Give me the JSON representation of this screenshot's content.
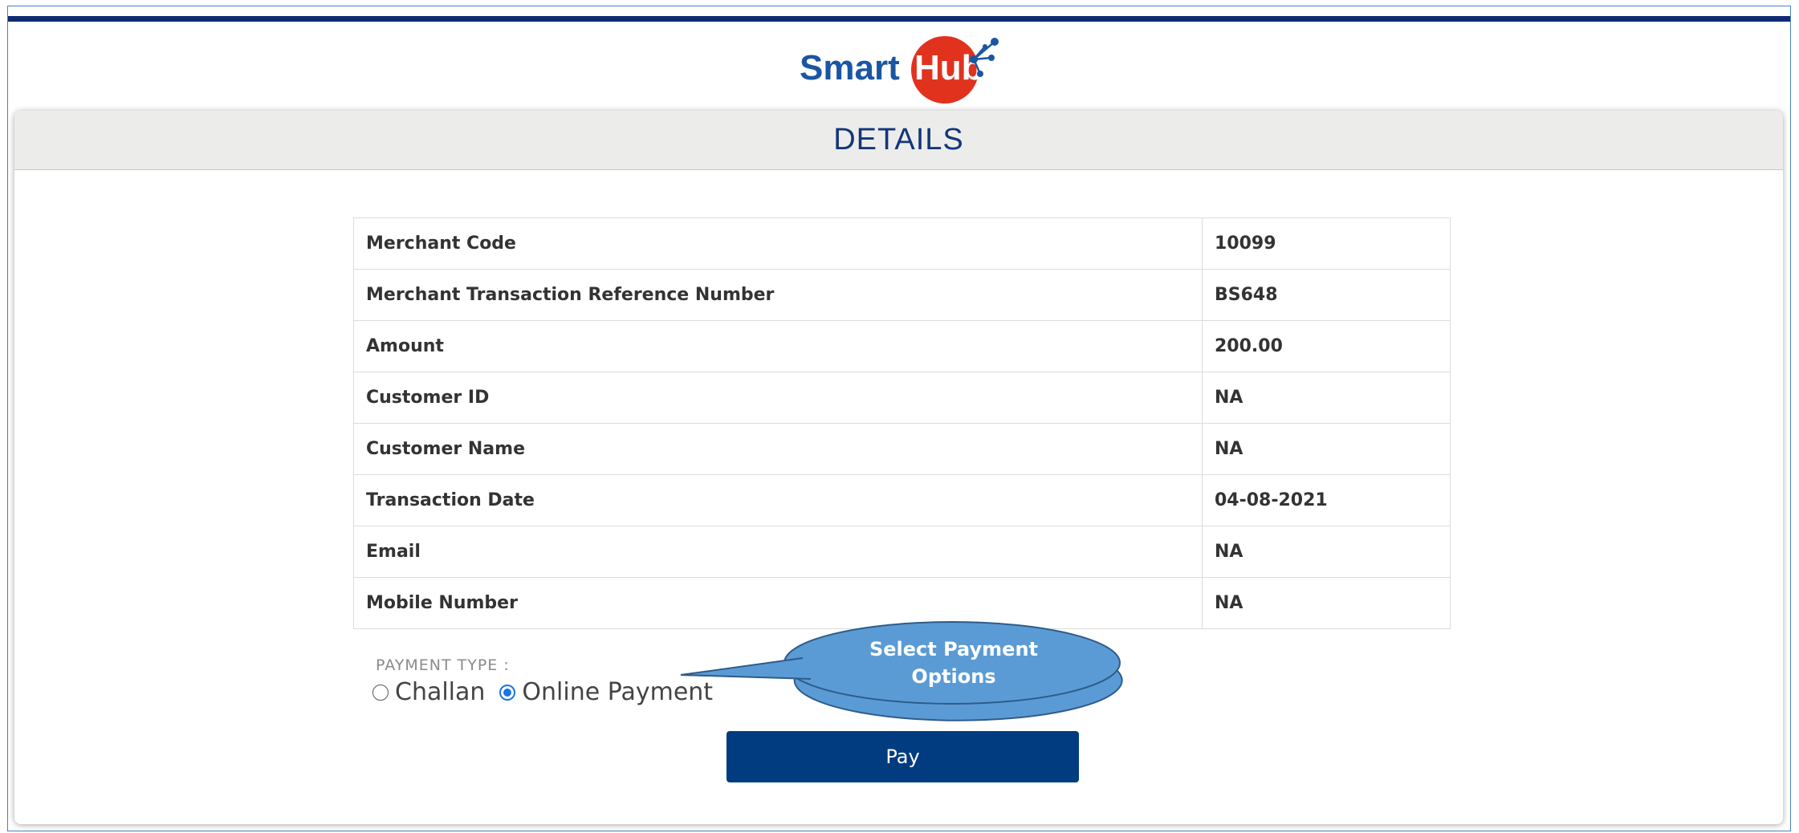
{
  "brand": {
    "smart": "Smart",
    "hub": "Hub"
  },
  "header": {
    "title": "DETAILS"
  },
  "details": [
    {
      "label": "Merchant Code",
      "value": "10099"
    },
    {
      "label": "Merchant Transaction Reference Number",
      "value": "BS648"
    },
    {
      "label": "Amount",
      "value": "200.00"
    },
    {
      "label": "Customer ID",
      "value": "NA"
    },
    {
      "label": "Customer Name",
      "value": "NA"
    },
    {
      "label": "Transaction Date",
      "value": "04-08-2021"
    },
    {
      "label": "Email",
      "value": "NA"
    },
    {
      "label": "Mobile Number",
      "value": "NA"
    }
  ],
  "payment": {
    "type_label": "PAYMENT TYPE :",
    "options": [
      {
        "label": "Challan",
        "selected": false
      },
      {
        "label": "Online Payment",
        "selected": true
      }
    ],
    "pay_label": "Pay"
  },
  "callout": {
    "line1": "Select Payment",
    "line2": "Options"
  },
  "colors": {
    "navy_bar": "#0f2c73",
    "pay_button": "#003c7f",
    "title": "#14357a",
    "callout_fill": "#5b9bd5",
    "hub_red": "#e1321e"
  }
}
